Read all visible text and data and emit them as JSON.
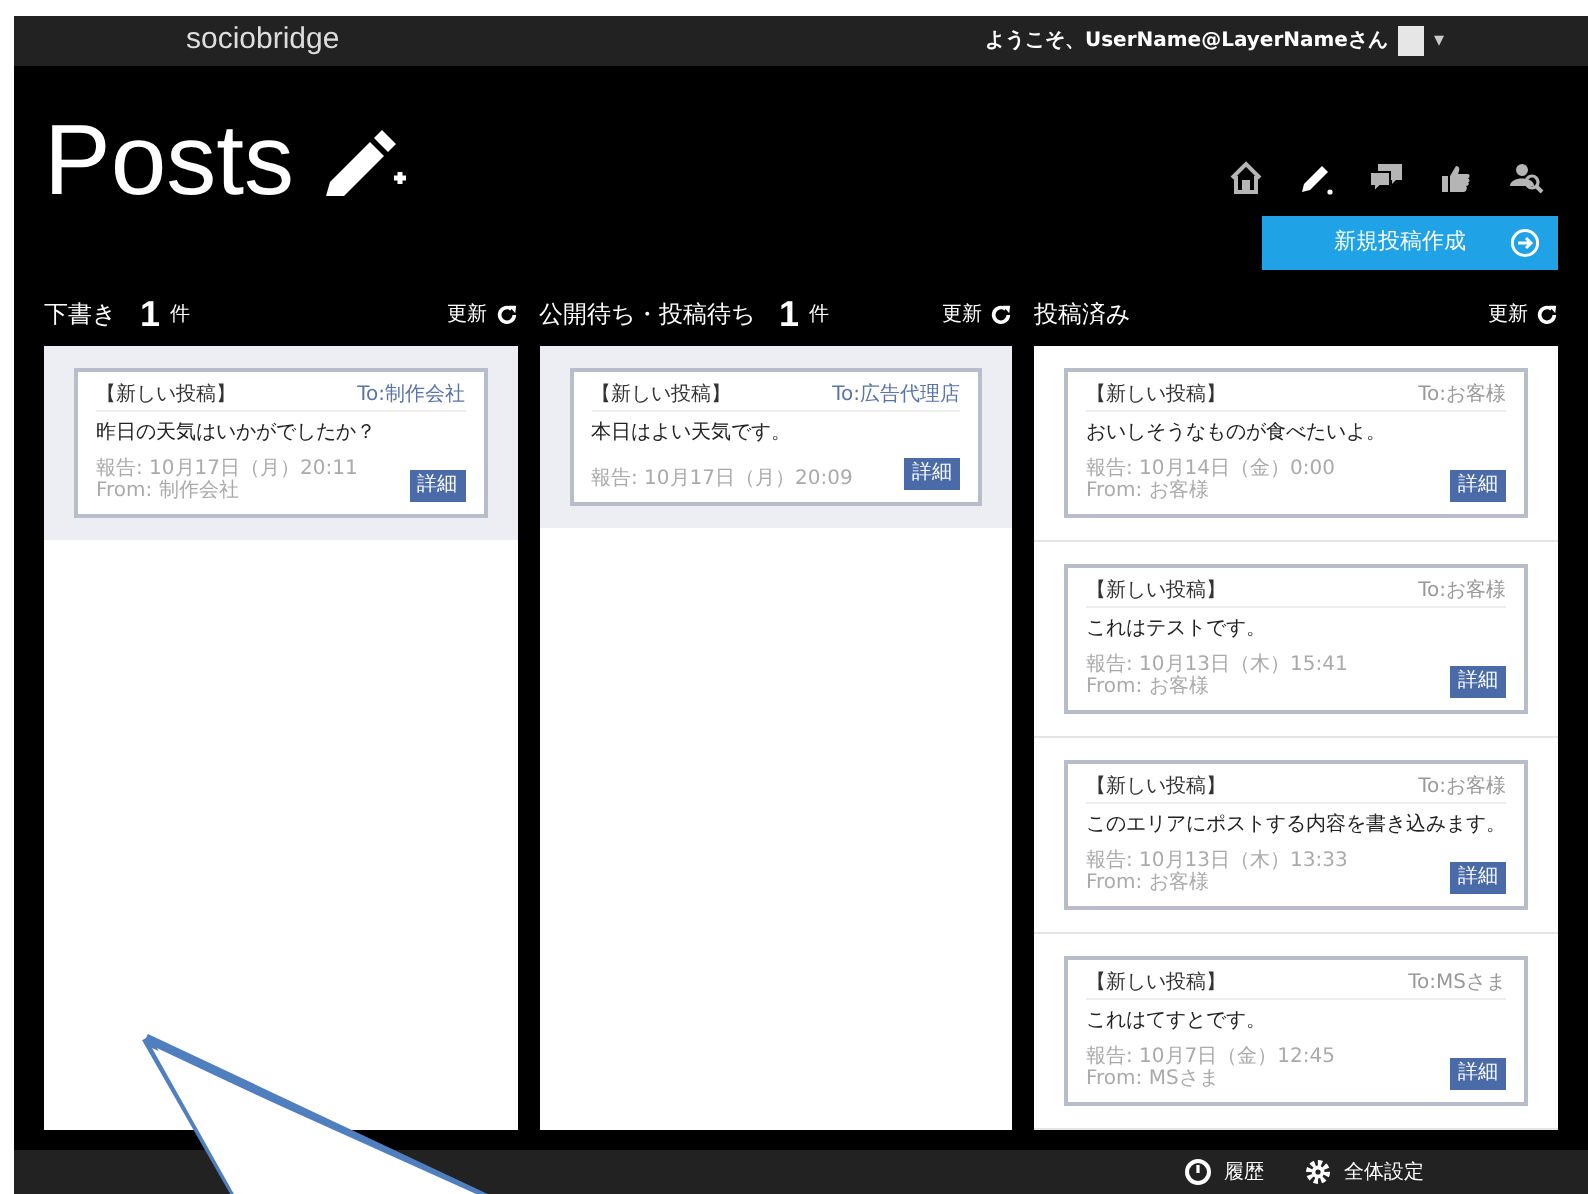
{
  "app": {
    "logo": "sociobridge",
    "welcome": "ようこそ、UserName@LayerNameさん",
    "caret": "▾"
  },
  "page": {
    "title": "Posts"
  },
  "nav": [
    {
      "kind": "home",
      "selected": false
    },
    {
      "kind": "pen",
      "selected": true
    },
    {
      "kind": "chat",
      "selected": false
    },
    {
      "kind": "like",
      "selected": false
    },
    {
      "kind": "search",
      "selected": false
    }
  ],
  "new_post_button": "新規投稿作成",
  "columns": [
    {
      "title": "下書き",
      "count": "1",
      "count_unit": "件",
      "refresh": "更新",
      "posts": [
        {
          "tag": "【新しい投稿】",
          "to": "To:制作会社",
          "body": "昨日の天気はいかがでしたか？",
          "date": "報告: 10月17日（月）20:11",
          "from": "From: 制作会社",
          "button": "詳細",
          "highlighted": true
        }
      ]
    },
    {
      "title": "公開待ち・投稿待ち",
      "count": "1",
      "count_unit": "件",
      "refresh": "更新",
      "posts": [
        {
          "tag": "【新しい投稿】",
          "to": "To:広告代理店",
          "body": "本日はよい天気です。",
          "date": "報告: 10月17日（月）20:09",
          "button": "詳細",
          "highlighted": true
        }
      ]
    },
    {
      "title": "投稿済み",
      "refresh": "更新",
      "posts": [
        {
          "tag": "【新しい投稿】",
          "to": "To:お客様",
          "body": "おいしそうなものが食べたいよ。",
          "date": "報告: 10月14日（金）0:00",
          "from": "From: お客様",
          "button": "詳細",
          "highlighted": false
        },
        {
          "tag": "【新しい投稿】",
          "to": "To:お客様",
          "body": "これはテストです。",
          "date": "報告: 10月13日（木）15:41",
          "from": "From: お客様",
          "button": "詳細",
          "highlighted": false
        },
        {
          "tag": "【新しい投稿】",
          "to": "To:お客様",
          "body": "このエリアにポストする内容を書き込みます。",
          "date": "報告: 10月13日（木）13:33",
          "from": "From: お客様",
          "button": "詳細",
          "highlighted": false
        },
        {
          "tag": "【新しい投稿】",
          "to": "To:MSさま",
          "body": "これはてすとです。",
          "date": "報告: 10月7日（金）12:45",
          "from": "From: MSさま",
          "button": "詳細",
          "highlighted": false
        }
      ]
    }
  ],
  "footer": [
    {
      "kind": "history",
      "label": "履歴"
    },
    {
      "kind": "settings",
      "label": "全体設定"
    }
  ]
}
